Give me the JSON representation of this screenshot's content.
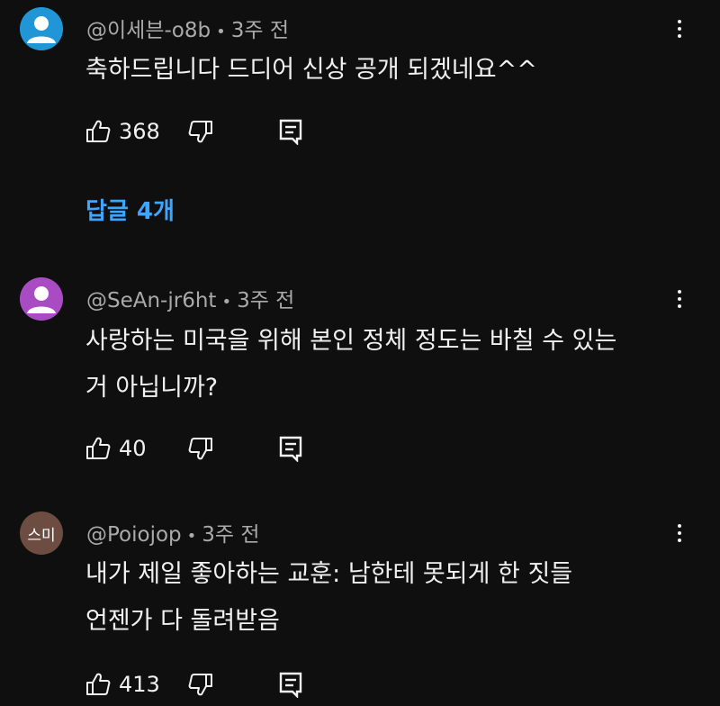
{
  "colors": {
    "background": "#0f0f0f",
    "text": "#f1f1f1",
    "meta": "#aaaaaa",
    "link": "#3ea6ff"
  },
  "comments": [
    {
      "author": "@이세븐-o8b",
      "time": "3주 전",
      "text": "축하드립니다 드디어 신상 공개 되겠네요^^",
      "likes": "368",
      "avatar": {
        "type": "default-person-icon",
        "color": "#2196d6"
      },
      "replies_label": "답글 4개"
    },
    {
      "author": "@SeAn-jr6ht",
      "time": "3주 전",
      "text_lines": [
        "사랑하는 미국을 위해 본인 정체 정도는 바칠 수 있는",
        "거 아닙니까?"
      ],
      "likes": "40",
      "avatar": {
        "type": "default-person-icon",
        "color": "#a94cc4"
      }
    },
    {
      "author": "@Poiojop",
      "time": "3주 전",
      "text_lines": [
        "내가 제일 좋아하는 교훈: 남한테 못되게 한 짓들",
        "언젠가 다 돌려받음"
      ],
      "likes": "413",
      "avatar": {
        "type": "text",
        "text": "스미",
        "color": "#6d4c41"
      }
    }
  ],
  "icons": {
    "like": "thumbs-up-icon",
    "dislike": "thumbs-down-icon",
    "reply": "reply-comment-icon",
    "menu": "more-vertical-icon"
  }
}
